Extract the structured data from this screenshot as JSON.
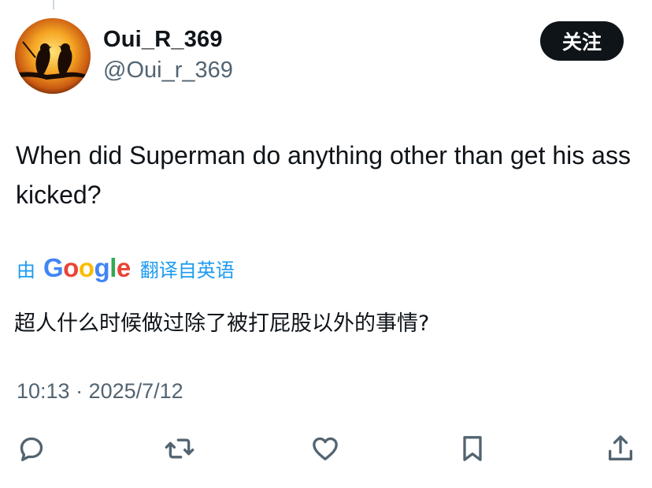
{
  "tweet": {
    "author": {
      "display_name": "Oui_R_369",
      "handle": "@Oui_r_369",
      "avatar": "avatar-birds-sunset"
    },
    "follow_label": "关注",
    "text": "When did Superman do anything other than get his ass kicked?",
    "translation": {
      "prefix": "由",
      "brand": "Google",
      "suffix": "翻译自英语",
      "text": "超人什么时候做过除了被打屁股以外的事情?"
    },
    "timestamp": "10:13 · 2025/7/12",
    "actions": [
      {
        "name": "reply",
        "icon": "reply-icon"
      },
      {
        "name": "retweet",
        "icon": "retweet-icon"
      },
      {
        "name": "like",
        "icon": "heart-icon"
      },
      {
        "name": "bookmark",
        "icon": "bookmark-icon"
      },
      {
        "name": "share",
        "icon": "share-icon"
      }
    ]
  },
  "colors": {
    "text": "#0f1419",
    "secondary": "#536471",
    "link": "#1d9bf0",
    "button_bg": "#0f1419"
  }
}
